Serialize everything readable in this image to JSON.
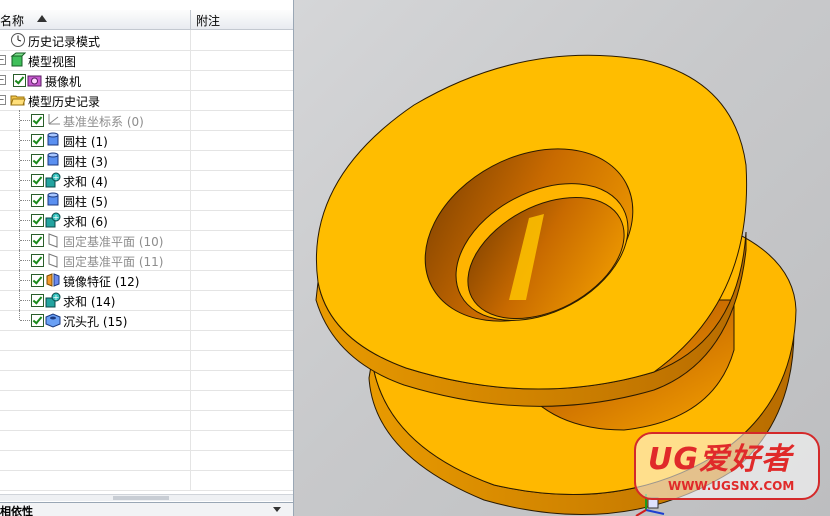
{
  "navigator": {
    "columns": {
      "name": "名称",
      "comment": "附注"
    },
    "rows": [
      {
        "label": "历史记录模式",
        "icon": "clock-icon",
        "level": 0,
        "expand": false,
        "checked": false,
        "gray": false
      },
      {
        "label": "模型视图",
        "icon": "model-view-icon",
        "level": 0,
        "expand": true,
        "checked": false,
        "gray": false
      },
      {
        "label": "摄像机",
        "icon": "camera-icon",
        "level": 0,
        "expand": true,
        "checked": true,
        "gray": false
      },
      {
        "label": "模型历史记录",
        "icon": "folder-open-icon",
        "level": 0,
        "expand": true,
        "checked": false,
        "gray": false
      },
      {
        "label": "基准坐标系 (0)",
        "icon": "datum-csys-icon",
        "level": 1,
        "checked": true,
        "gray": true
      },
      {
        "label": "圆柱 (1)",
        "icon": "cylinder-icon",
        "level": 1,
        "checked": true,
        "gray": false
      },
      {
        "label": "圆柱 (3)",
        "icon": "cylinder-icon",
        "level": 1,
        "checked": true,
        "gray": false
      },
      {
        "label": "求和 (4)",
        "icon": "unite-icon",
        "level": 1,
        "checked": true,
        "gray": false
      },
      {
        "label": "圆柱 (5)",
        "icon": "cylinder-icon",
        "level": 1,
        "checked": true,
        "gray": false
      },
      {
        "label": "求和 (6)",
        "icon": "unite-icon",
        "level": 1,
        "checked": true,
        "gray": false
      },
      {
        "label": "固定基准平面 (10)",
        "icon": "datum-plane-icon",
        "level": 1,
        "checked": true,
        "gray": true
      },
      {
        "label": "固定基准平面 (11)",
        "icon": "datum-plane-icon",
        "level": 1,
        "checked": true,
        "gray": true
      },
      {
        "label": "镜像特征 (12)",
        "icon": "mirror-feature-icon",
        "level": 1,
        "checked": true,
        "gray": false
      },
      {
        "label": "求和 (14)",
        "icon": "unite-icon",
        "level": 1,
        "checked": true,
        "gray": false
      },
      {
        "label": "沉头孔 (15)",
        "icon": "counterbore-hole-icon",
        "level": 1,
        "checked": true,
        "gray": false
      }
    ],
    "bottom_panel_title": "相依性"
  },
  "watermark": {
    "title": "UG爱好者",
    "url": "WWW.UGSNX.COM"
  },
  "colors": {
    "part": "#FFB800",
    "part_dark": "#9C5A00",
    "background": "#C8C9CB",
    "watermark": "#E02A2A"
  }
}
